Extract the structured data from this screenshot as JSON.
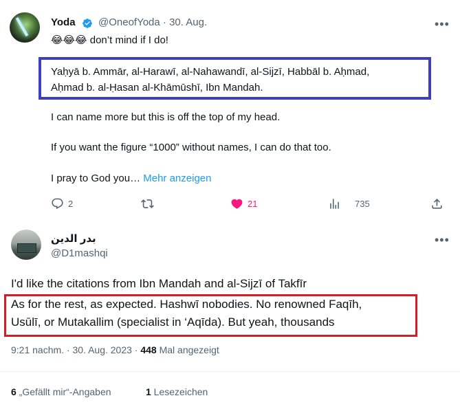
{
  "tweet1": {
    "name": "Yoda",
    "handle": "@OneofYoda",
    "date": "30. Aug.",
    "line1": "😂😂😂 don’t mind if I do!",
    "quote_line1": "Yaḥyā b. Ammār, al-Harawī, al-Nahawandī, al-Sijzī, Habbāl b. Aḥmad,",
    "quote_line2": "Aḥmad b. al-Ḥasan al-Khāmūshī, Ibn Mandah.",
    "para2": "I can name more but this is off the top of my head.",
    "para3": "If you want the figure “1000” without names, I can do that too.",
    "para4": "I pray to God you…",
    "show_more": "Mehr anzeigen",
    "replies": "2",
    "likes": "21",
    "views": "735"
  },
  "tweet2": {
    "name": "بدر الدين",
    "handle": "@D1mashqi",
    "line1": "I'd like the citations from Ibn Mandah and al-Sijzī of Takfīr",
    "line2": "As for the rest, as expected. Hashwī nobodies. No renowned Faqīh,",
    "line3": "Usūlī, or Mutakallim (specialist in ‘Aqīda). But yeah, thousands",
    "time": "9:21 nachm. · 30. Aug. 2023 · ",
    "view_count": "448",
    "view_label": " Mal angezeigt",
    "likes_count": "6",
    "likes_label": " „Gefällt mir“-Angaben",
    "bookmarks_count": "1",
    "bookmarks_label": " Lesezeichen"
  },
  "colors": {
    "accent": "#1d9bf0",
    "like": "#f91880",
    "blue_box": "#3e3fc0",
    "red_box": "#d01f2a"
  },
  "icons": [
    "verified-icon",
    "more-icon",
    "reply-icon",
    "retweet-icon",
    "heart-icon",
    "views-icon",
    "share-icon"
  ]
}
